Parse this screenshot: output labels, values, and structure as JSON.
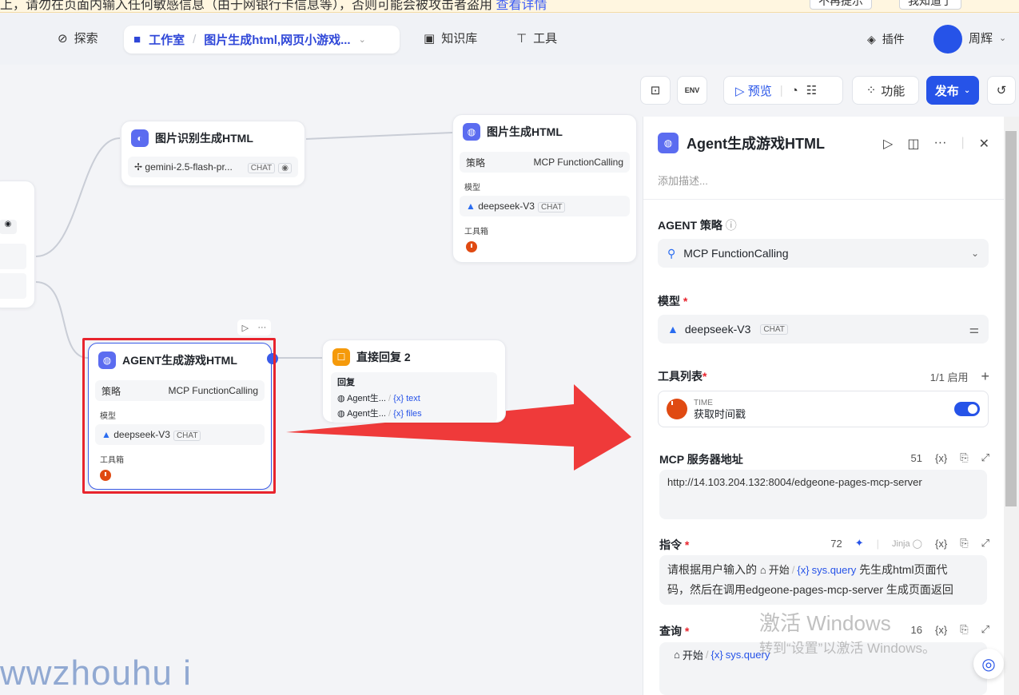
{
  "notice": {
    "text": "上，请勿在页面内输入任何敏感信息（由于网银行卡信息等），否则可能会被攻击者盗用",
    "link": "查看详情",
    "btn_no_remind": "不再提示",
    "btn_known": "我知道了"
  },
  "nav": {
    "explore": "探索",
    "studio": "工作室",
    "current": "图片生成html,网页小游戏...",
    "knowledge": "知识库",
    "tools": "工具",
    "plugins": "插件",
    "user": "周辉"
  },
  "toolbar": {
    "preview": "预览",
    "features": "功能",
    "publish": "发布",
    "env": "ENV"
  },
  "nodes": {
    "img_recog": {
      "title": "图片识别生成HTML",
      "model": "gemini-2.5-flash-pr...",
      "tag": "CHAT"
    },
    "img_gen": {
      "title": "图片生成HTML",
      "strategy_label": "策略",
      "strategy": "MCP FunctionCalling",
      "model_label": "模型",
      "model": "deepseek-V3",
      "tag": "CHAT",
      "tools_label": "工具箱"
    },
    "agent": {
      "title": "AGENT生成游戏HTML",
      "strategy_label": "策略",
      "strategy": "MCP FunctionCalling",
      "model_label": "模型",
      "model": "deepseek-V3",
      "tag": "CHAT",
      "tools_label": "工具箱"
    },
    "reply": {
      "title": "直接回复 2",
      "reply_label": "回复",
      "item1_src": "Agent生...",
      "item1_var": "text",
      "item2_src": "Agent生...",
      "item2_var": "files"
    }
  },
  "panel": {
    "title": "Agent生成游戏HTML",
    "desc_placeholder": "添加描述...",
    "strategy_label": "AGENT 策略",
    "strategy_value": "MCP FunctionCalling",
    "model_label": "模型",
    "model_value": "deepseek-V3",
    "model_tag": "CHAT",
    "tools_label": "工具列表",
    "tools_count": "1/1 启用",
    "tool_type": "TIME",
    "tool_name": "获取时间戳",
    "mcp_label": "MCP 服务器地址",
    "mcp_count": "51",
    "mcp_value": "http://14.103.204.132:8004/edgeone-pages-mcp-server",
    "instr_label": "指令",
    "instr_count": "72",
    "jinja": "Jinja",
    "instr_pre": "请根据用户输入的",
    "instr_start": "开始",
    "instr_var": "sys.query",
    "instr_post1": "先生成html页面代",
    "instr_post2": "码，然后在调用edgeone-pages-mcp-server 生成页面返回",
    "query_label": "查询",
    "query_count": "16",
    "query_start": "开始",
    "query_var": "sys.query",
    "var_symbol": "{x}"
  },
  "watermark": {
    "line1": "激活 Windows",
    "line2": "转到“设置”以激活 Windows。",
    "site": "wwzhouhu i"
  }
}
